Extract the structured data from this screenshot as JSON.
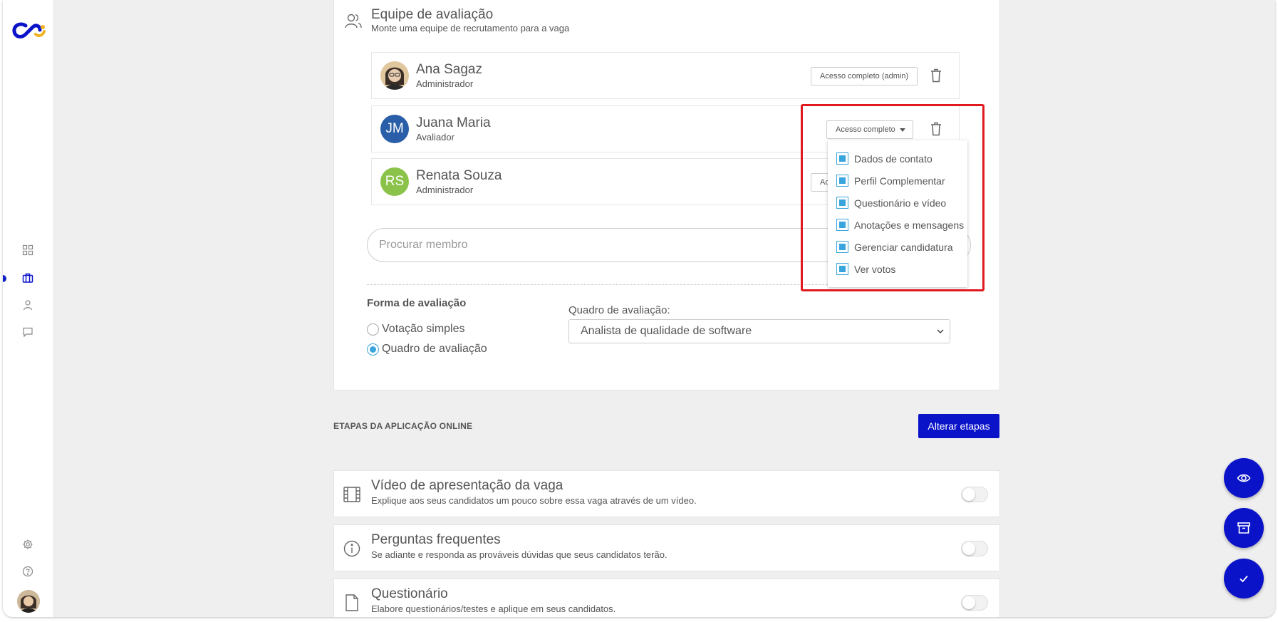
{
  "colors": {
    "brand": "#0b13c9",
    "accent": "#3aa5dd",
    "highlight": "#e0191f"
  },
  "sidebar": {
    "items": [
      {
        "icon": "grid-icon"
      },
      {
        "icon": "briefcase-icon",
        "active": true
      },
      {
        "icon": "user-icon"
      },
      {
        "icon": "chat-icon"
      }
    ],
    "bottom": [
      {
        "icon": "gear-icon"
      },
      {
        "icon": "help-icon"
      }
    ]
  },
  "team": {
    "title": "Equipe de avaliação",
    "subtitle": "Monte uma equipe de recrutamento para a vaga",
    "members": [
      {
        "name": "Ana Sagaz",
        "role": "Administrador",
        "initials": "",
        "access": "Acesso completo (admin)"
      },
      {
        "name": "Juana Maria",
        "role": "Avaliador",
        "initials": "JM",
        "access": "Acesso completo"
      },
      {
        "name": "Renata Souza",
        "role": "Administrador",
        "initials": "RS",
        "access": "Ac"
      }
    ],
    "search_placeholder": "Procurar membro",
    "access_options": [
      "Dados de contato",
      "Perfil Complementar",
      "Questionário e vídeo",
      "Anotações e mensagens",
      "Gerenciar candidatura",
      "Ver votos"
    ],
    "eval_form_title": "Forma de avaliação",
    "eval_options": [
      {
        "label": "Votação simples",
        "selected": false
      },
      {
        "label": "Quadro de avaliação",
        "selected": true
      }
    ],
    "board_label": "Quadro de avaliação:",
    "board_value": "Analista de qualidade de software"
  },
  "steps": {
    "title": "ETAPAS DA APLICAÇÃO ONLINE",
    "button": "Alterar etapas",
    "items": [
      {
        "title": "Vídeo de apresentação da vaga",
        "subtitle": "Explique aos seus candidatos um pouco sobre essa vaga através de um vídeo.",
        "enabled": false
      },
      {
        "title": "Perguntas frequentes",
        "subtitle": "Se adiante e responda as prováveis dúvidas que seus candidatos terão.",
        "enabled": false
      },
      {
        "title": "Questionário",
        "subtitle": "Elabore questionários/testes e aplique em seus candidatos.",
        "enabled": false
      }
    ]
  },
  "fabs": [
    {
      "icon": "eye-icon"
    },
    {
      "icon": "archive-icon"
    },
    {
      "icon": "check-icon"
    }
  ]
}
